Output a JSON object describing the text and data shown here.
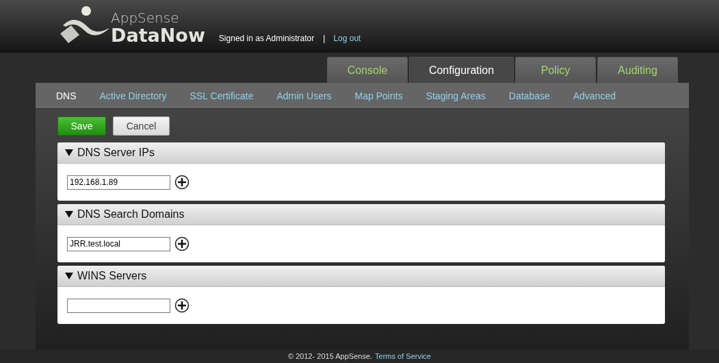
{
  "header": {
    "brand_top": "AppSense",
    "brand_bottom": "DataNow",
    "signed_in": "Signed in as Administrator",
    "separator": "|",
    "logout": "Log out"
  },
  "tabs": [
    {
      "label": "Console",
      "selected": false
    },
    {
      "label": "Configuration",
      "selected": true
    },
    {
      "label": "Policy",
      "selected": false
    },
    {
      "label": "Auditing",
      "selected": false
    }
  ],
  "subnav": [
    {
      "label": "DNS",
      "selected": true
    },
    {
      "label": "Active Directory",
      "selected": false
    },
    {
      "label": "SSL Certificate",
      "selected": false
    },
    {
      "label": "Admin Users",
      "selected": false
    },
    {
      "label": "Map Points",
      "selected": false
    },
    {
      "label": "Staging Areas",
      "selected": false
    },
    {
      "label": "Database",
      "selected": false
    },
    {
      "label": "Advanced",
      "selected": false
    }
  ],
  "buttons": {
    "save": "Save",
    "cancel": "Cancel"
  },
  "sections": [
    {
      "title": "DNS Server IPs",
      "expanded": true,
      "value": "192.168.1.89"
    },
    {
      "title": "DNS Search Domains",
      "expanded": true,
      "value": "JRR.test.local"
    },
    {
      "title": "WINS Servers",
      "expanded": true
    }
  ],
  "footer": {
    "copyright": "© 2012- 2015 AppSense.",
    "terms": "Terms of Service"
  }
}
